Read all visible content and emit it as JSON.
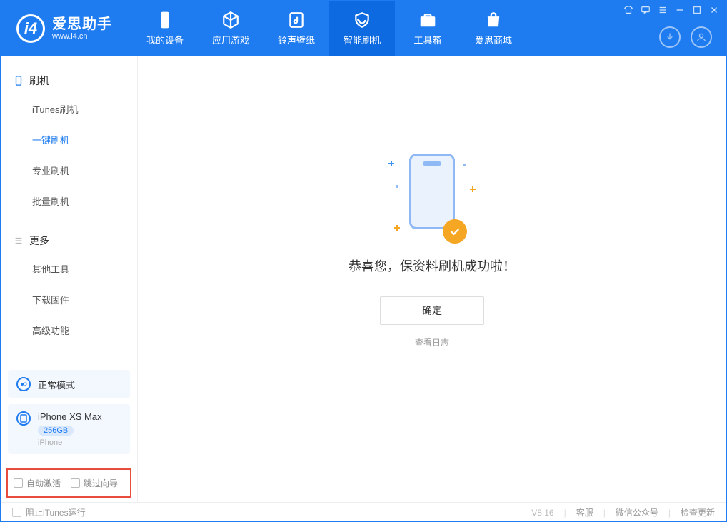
{
  "header": {
    "logo_title": "爱思助手",
    "logo_sub": "www.i4.cn",
    "tabs": [
      {
        "label": "我的设备"
      },
      {
        "label": "应用游戏"
      },
      {
        "label": "铃声壁纸"
      },
      {
        "label": "智能刷机"
      },
      {
        "label": "工具箱"
      },
      {
        "label": "爱思商城"
      }
    ]
  },
  "sidebar": {
    "section1_title": "刷机",
    "items1": [
      {
        "label": "iTunes刷机"
      },
      {
        "label": "一键刷机"
      },
      {
        "label": "专业刷机"
      },
      {
        "label": "批量刷机"
      }
    ],
    "section2_title": "更多",
    "items2": [
      {
        "label": "其他工具"
      },
      {
        "label": "下载固件"
      },
      {
        "label": "高级功能"
      }
    ],
    "mode_label": "正常模式",
    "device": {
      "name": "iPhone XS Max",
      "storage": "256GB",
      "type": "iPhone"
    },
    "checkbox_auto_activate": "自动激活",
    "checkbox_skip_guide": "跳过向导"
  },
  "main": {
    "success_text": "恭喜您，保资料刷机成功啦！",
    "ok_button": "确定",
    "view_log": "查看日志"
  },
  "footer": {
    "block_itunes": "阻止iTunes运行",
    "version": "V8.16",
    "customer_service": "客服",
    "wechat": "微信公众号",
    "check_update": "检查更新"
  }
}
